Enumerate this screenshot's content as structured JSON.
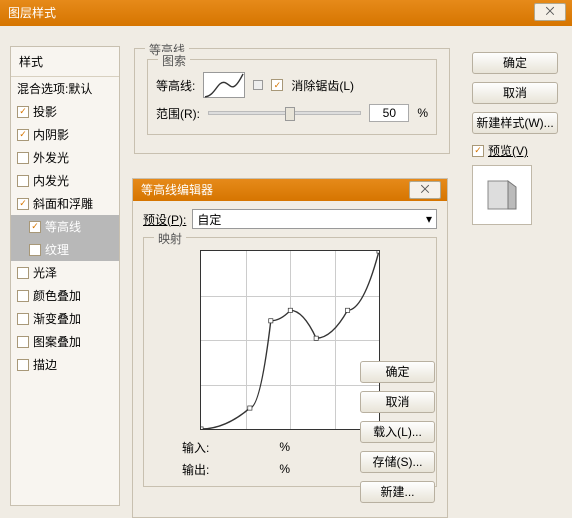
{
  "window": {
    "title": "图层样式",
    "close": "⨉"
  },
  "styles": {
    "header": "样式",
    "blending": "混合选项:默认",
    "items": [
      {
        "label": "投影",
        "checked": true
      },
      {
        "label": "内阴影",
        "checked": true
      },
      {
        "label": "外发光",
        "checked": false
      },
      {
        "label": "内发光",
        "checked": false
      },
      {
        "label": "斜面和浮雕",
        "checked": true,
        "selected": false
      },
      {
        "label": "等高线",
        "checked": true,
        "sub": true,
        "selected": true
      },
      {
        "label": "纹理",
        "checked": false,
        "sub": true,
        "selected": true
      },
      {
        "label": "光泽",
        "checked": false
      },
      {
        "label": "颜色叠加",
        "checked": false
      },
      {
        "label": "渐变叠加",
        "checked": false
      },
      {
        "label": "图案叠加",
        "checked": false
      },
      {
        "label": "描边",
        "checked": false
      }
    ]
  },
  "contour_panel": {
    "legend": "等高线",
    "sublegend": "图索",
    "contour_label": "等高线:",
    "antialias_label": "消除锯齿(L)",
    "antialias_checked": true,
    "range_label": "范围(R):",
    "range_value": "50",
    "range_unit": "%"
  },
  "editor": {
    "title": "等高线编辑器",
    "close": "⨉",
    "preset_label": "预设(P):",
    "preset_value": "自定",
    "mapping_legend": "映射",
    "input_label": "输入:",
    "input_value": "",
    "input_unit": "%",
    "output_label": "输出:",
    "output_value": "",
    "output_unit": "%",
    "buttons": {
      "ok": "确定",
      "cancel": "取消",
      "load": "载入(L)...",
      "save": "存储(S)...",
      "new": "新建..."
    }
  },
  "right": {
    "ok": "确定",
    "cancel": "取消",
    "newstyle": "新建样式(W)...",
    "preview_label": "预览(V)",
    "preview_checked": true
  },
  "chart_data": {
    "type": "line",
    "title": "映射",
    "xlabel": "输入",
    "ylabel": "输出",
    "xlim": [
      0,
      255
    ],
    "ylim": [
      0,
      255
    ],
    "points": [
      {
        "x": 0,
        "y": 0
      },
      {
        "x": 70,
        "y": 30
      },
      {
        "x": 100,
        "y": 155
      },
      {
        "x": 128,
        "y": 170
      },
      {
        "x": 165,
        "y": 130
      },
      {
        "x": 210,
        "y": 170
      },
      {
        "x": 255,
        "y": 255
      }
    ]
  }
}
